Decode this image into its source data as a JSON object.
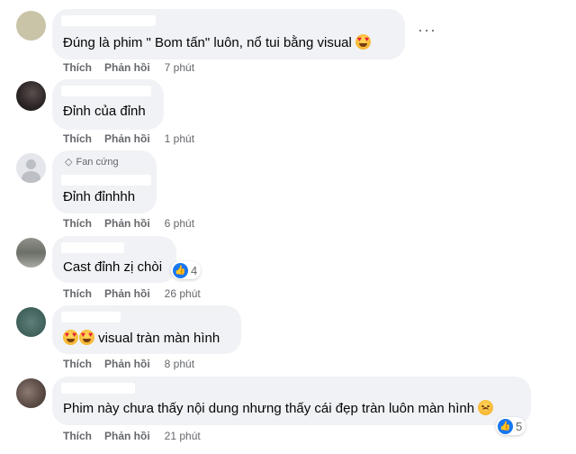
{
  "actions": {
    "like": "Thích",
    "reply": "Phản hồi"
  },
  "comments": [
    {
      "text": "Đúng là phim \" Bom tấn\" luôn, nổ tui bằng visual",
      "time": "7 phút",
      "avatar_color": "#c9c4a8"
    },
    {
      "text": "Đỉnh của đỉnh",
      "time": "1 phút",
      "avatar_color": "#3b3535"
    },
    {
      "badge": "Fan cứng",
      "text": "Đỉnh đỉnhhh",
      "time": "6 phút",
      "avatar_color": "#e4e6eb"
    },
    {
      "text": "Cast đỉnh zị chòi",
      "time": "26 phút",
      "reaction_count": "4",
      "avatar_color": "#7d8078"
    },
    {
      "text": "visual tràn màn hình",
      "time": "8 phút",
      "avatar_color": "#3f5f5a"
    },
    {
      "text": "Phim này chưa thấy nội dung nhưng thấy cái đẹp tràn luôn màn hình",
      "time": "21 phút",
      "reaction_count": "5",
      "avatar_color": "#6a5a55"
    }
  ],
  "icons": {
    "more": "more-options-icon",
    "like": "like-reaction-icon",
    "badge": "diamond-icon"
  },
  "colors": {
    "bubble": "#f0f2f5",
    "meta": "#65676b",
    "like_blue": "#1877f2"
  }
}
